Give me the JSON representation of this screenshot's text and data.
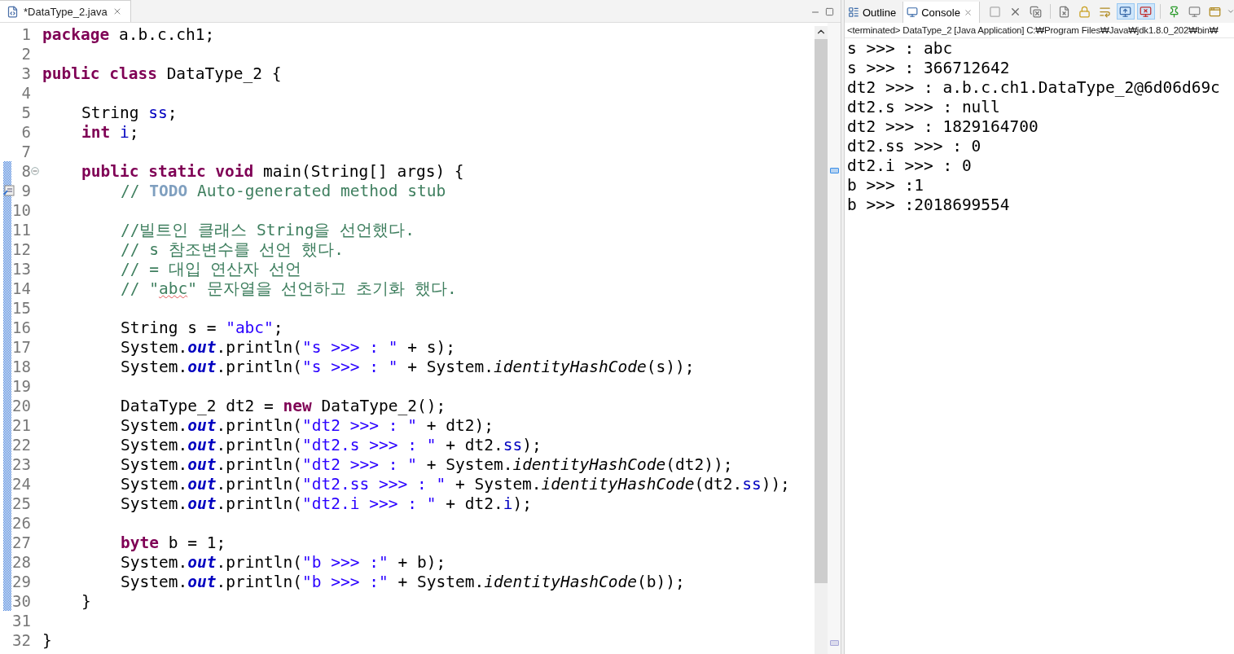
{
  "editor": {
    "tab": {
      "title": "*DataType_2.java",
      "selected": true
    },
    "lines": [
      {
        "number": "1",
        "kind": "top",
        "tokens": [
          {
            "kind": "kw",
            "text": "package"
          },
          {
            "kind": "plain",
            "text": " a.b.c.ch1;"
          }
        ]
      },
      {
        "number": "2"
      },
      {
        "number": "3",
        "kind": "top",
        "tokens": [
          {
            "kind": "kw",
            "text": "public class"
          },
          {
            "kind": "plain",
            "text": " DataType_2 {"
          }
        ]
      },
      {
        "number": "4"
      },
      {
        "number": "5",
        "kind": "class",
        "tokens": [
          {
            "kind": "plain",
            "text": "String "
          },
          {
            "kind": "field",
            "text": "ss"
          },
          {
            "kind": "plain",
            "text": ";"
          }
        ]
      },
      {
        "number": "6",
        "kind": "class",
        "tokens": [
          {
            "kind": "kw",
            "text": "int"
          },
          {
            "kind": "field",
            "text": " i"
          },
          {
            "kind": "plain",
            "text": ";"
          }
        ]
      },
      {
        "number": "7"
      },
      {
        "number": "8",
        "kind": "class",
        "expanded": true,
        "in_range": true,
        "tokens": [
          {
            "kind": "kw",
            "text": "public static void"
          },
          {
            "kind": "plain",
            "text": " main(String[] args) {"
          }
        ]
      },
      {
        "number": "9",
        "kind": "method",
        "task": true,
        "in_range": true,
        "tokens": [
          {
            "kind": "comment",
            "text": "// "
          },
          {
            "kind": "todo",
            "text": "TODO"
          },
          {
            "kind": "comment",
            "text": " Auto-generated method stub"
          }
        ]
      },
      {
        "number": "10",
        "in_range": true
      },
      {
        "number": "11",
        "kind": "method",
        "in_range": true,
        "tokens": [
          {
            "kind": "comment",
            "text": "//빌트인 클래스 String을 선언했다."
          }
        ]
      },
      {
        "number": "12",
        "kind": "method",
        "in_range": true,
        "tokens": [
          {
            "kind": "comment",
            "text": "// s 참조변수를 선언 했다."
          }
        ]
      },
      {
        "number": "13",
        "kind": "method",
        "in_range": true,
        "tokens": [
          {
            "kind": "comment",
            "text": "// = 대입 연산자 선언"
          }
        ]
      },
      {
        "number": "14",
        "kind": "method",
        "in_range": true,
        "tokens": [
          {
            "kind": "comment",
            "text": "// \""
          },
          {
            "kind": "comment",
            "text": "abc",
            "misspelled": true
          },
          {
            "kind": "comment",
            "text": "\" 문자열을 선언하고 초기화 했다."
          }
        ]
      },
      {
        "number": "15",
        "in_range": true
      },
      {
        "number": "16",
        "kind": "method",
        "in_range": true,
        "tokens": [
          {
            "kind": "plain",
            "text": "String s = "
          },
          {
            "kind": "str",
            "text": "\"abc\""
          },
          {
            "kind": "plain",
            "text": ";"
          }
        ]
      },
      {
        "number": "17",
        "kind": "method",
        "in_range": true,
        "tokens": [
          {
            "kind": "plain",
            "text": "System."
          },
          {
            "kind": "static",
            "text": "out"
          },
          {
            "kind": "plain",
            "text": ".println("
          },
          {
            "kind": "str",
            "text": "\"s >>> : \""
          },
          {
            "kind": "plain",
            "text": " + s);"
          }
        ]
      },
      {
        "number": "18",
        "kind": "method",
        "in_range": true,
        "tokens": [
          {
            "kind": "plain",
            "text": "System."
          },
          {
            "kind": "static",
            "text": "out"
          },
          {
            "kind": "plain",
            "text": ".println("
          },
          {
            "kind": "str",
            "text": "\"s >>> : \""
          },
          {
            "kind": "plain",
            "text": " + System."
          },
          {
            "kind": "method",
            "text": "identityHashCode"
          },
          {
            "kind": "plain",
            "text": "(s));"
          }
        ]
      },
      {
        "number": "19",
        "in_range": true
      },
      {
        "number": "20",
        "kind": "method",
        "in_range": true,
        "tokens": [
          {
            "kind": "plain",
            "text": "DataType_2 dt2 = "
          },
          {
            "kind": "kw",
            "text": "new"
          },
          {
            "kind": "plain",
            "text": " DataType_2();"
          }
        ]
      },
      {
        "number": "21",
        "kind": "method",
        "in_range": true,
        "tokens": [
          {
            "kind": "plain",
            "text": "System."
          },
          {
            "kind": "static",
            "text": "out"
          },
          {
            "kind": "plain",
            "text": ".println("
          },
          {
            "kind": "str",
            "text": "\"dt2 >>> : \""
          },
          {
            "kind": "plain",
            "text": " + dt2);"
          }
        ]
      },
      {
        "number": "22",
        "kind": "method",
        "in_range": true,
        "tokens": [
          {
            "kind": "plain",
            "text": "System."
          },
          {
            "kind": "static",
            "text": "out"
          },
          {
            "kind": "plain",
            "text": ".println("
          },
          {
            "kind": "str",
            "text": "\"dt2.s >>> : \""
          },
          {
            "kind": "plain",
            "text": " + dt2."
          },
          {
            "kind": "field",
            "text": "ss"
          },
          {
            "kind": "plain",
            "text": ");"
          }
        ]
      },
      {
        "number": "23",
        "kind": "method",
        "in_range": true,
        "tokens": [
          {
            "kind": "plain",
            "text": "System."
          },
          {
            "kind": "static",
            "text": "out"
          },
          {
            "kind": "plain",
            "text": ".println("
          },
          {
            "kind": "str",
            "text": "\"dt2 >>> : \""
          },
          {
            "kind": "plain",
            "text": " + System."
          },
          {
            "kind": "method",
            "text": "identityHashCode"
          },
          {
            "kind": "plain",
            "text": "(dt2));"
          }
        ]
      },
      {
        "number": "24",
        "kind": "method",
        "in_range": true,
        "tokens": [
          {
            "kind": "plain",
            "text": "System."
          },
          {
            "kind": "static",
            "text": "out"
          },
          {
            "kind": "plain",
            "text": ".println("
          },
          {
            "kind": "str",
            "text": "\"dt2.ss >>> : \""
          },
          {
            "kind": "plain",
            "text": " + System."
          },
          {
            "kind": "method",
            "text": "identityHashCode"
          },
          {
            "kind": "plain",
            "text": "(dt2."
          },
          {
            "kind": "field",
            "text": "ss"
          },
          {
            "kind": "plain",
            "text": "));"
          }
        ]
      },
      {
        "number": "25",
        "kind": "method",
        "in_range": true,
        "tokens": [
          {
            "kind": "plain",
            "text": "System."
          },
          {
            "kind": "static",
            "text": "out"
          },
          {
            "kind": "plain",
            "text": ".println("
          },
          {
            "kind": "str",
            "text": "\"dt2.i >>> : \""
          },
          {
            "kind": "plain",
            "text": " + dt2."
          },
          {
            "kind": "field",
            "text": "i"
          },
          {
            "kind": "plain",
            "text": ");"
          }
        ]
      },
      {
        "number": "26",
        "in_range": true
      },
      {
        "number": "27",
        "kind": "method",
        "in_range": true,
        "tokens": [
          {
            "kind": "kw",
            "text": "byte"
          },
          {
            "kind": "plain",
            "text": " b = 1;"
          }
        ]
      },
      {
        "number": "28",
        "kind": "method",
        "in_range": true,
        "tokens": [
          {
            "kind": "plain",
            "text": "System."
          },
          {
            "kind": "static",
            "text": "out"
          },
          {
            "kind": "plain",
            "text": ".println("
          },
          {
            "kind": "str",
            "text": "\"b >>> :\""
          },
          {
            "kind": "plain",
            "text": " + b);"
          }
        ]
      },
      {
        "number": "29",
        "kind": "method",
        "in_range": true,
        "tokens": [
          {
            "kind": "plain",
            "text": "System."
          },
          {
            "kind": "static",
            "text": "out"
          },
          {
            "kind": "plain",
            "text": ".println("
          },
          {
            "kind": "str",
            "text": "\"b >>> :\""
          },
          {
            "kind": "plain",
            "text": " + System."
          },
          {
            "kind": "method",
            "text": "identityHashCode"
          },
          {
            "kind": "plain",
            "text": "(b));"
          }
        ]
      },
      {
        "number": "30",
        "kind": "class",
        "in_range": true,
        "tokens": [
          {
            "kind": "plain",
            "text": "}"
          }
        ]
      },
      {
        "number": "31"
      },
      {
        "number": "32",
        "kind": "top",
        "tokens": [
          {
            "kind": "plain",
            "text": "}"
          }
        ]
      }
    ]
  },
  "side_panel": {
    "tabs": [
      {
        "label": "Outline",
        "kind": "outline",
        "selected": false
      },
      {
        "label": "Console",
        "kind": "console",
        "selected": true
      }
    ],
    "toolbar": [
      {
        "kind": "stop",
        "selected": false
      },
      {
        "kind": "remove",
        "selected": false
      },
      {
        "kind": "remove-all",
        "selected": false
      },
      {
        "kind": "sep"
      },
      {
        "kind": "clear",
        "selected": false
      },
      {
        "kind": "lock",
        "selected": false
      },
      {
        "kind": "wrap",
        "selected": false
      },
      {
        "kind": "show-out",
        "selected": true
      },
      {
        "kind": "show-err",
        "selected": true
      },
      {
        "kind": "sep"
      },
      {
        "kind": "pin",
        "selected": false
      },
      {
        "kind": "display",
        "selected": false
      },
      {
        "kind": "new",
        "selected": false
      }
    ],
    "status": "<terminated> DataType_2 [Java Application] C:₩Program Files₩Java₩jdk1.8.0_202₩bin₩",
    "output": [
      "s >>> : abc",
      "s >>> : 366712642",
      "dt2 >>> : a.b.c.ch1.DataType_2@6d06d69c",
      "dt2.s >>> : null",
      "dt2 >>> : 1829164700",
      "dt2.ss >>> : 0",
      "dt2.i >>> : 0",
      "b >>> :1",
      "b >>> :2018699554"
    ]
  }
}
